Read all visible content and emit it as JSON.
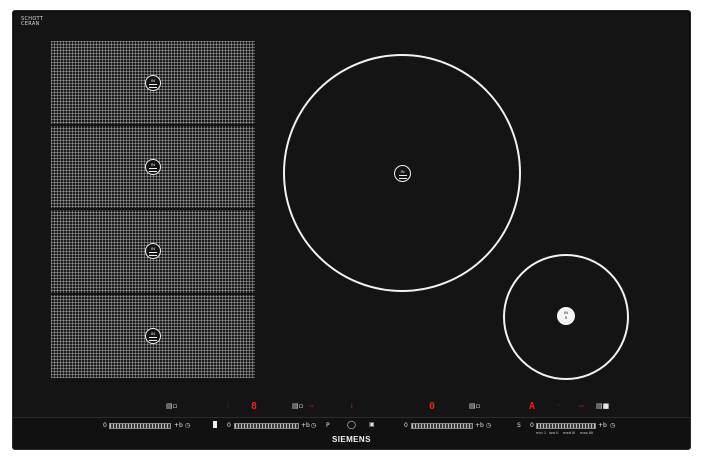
{
  "logo": {
    "line1": "SCHOTT",
    "line2": "CERAN",
    "line3": ""
  },
  "flex_zone": {
    "sections": [
      {
        "badge_label": "IN"
      },
      {
        "badge_label": "IN"
      },
      {
        "badge_label": "IN"
      },
      {
        "badge_label": "IN"
      }
    ]
  },
  "large_zone": {
    "badge_label": "IN"
  },
  "small_zone": {
    "badge_top": "IN",
    "badge_bottom": "S"
  },
  "displays": {
    "zone1_level": "8",
    "zone2_timer": "0",
    "zone3_level": "A",
    "zone3_small": "′′",
    "warn_indicator": "I"
  },
  "icons": {
    "flex_mode": "flex-mode-icon",
    "timer": "clock-icon",
    "power": "power-icon",
    "boost": "boost-icon",
    "lock": "lock-icon",
    "fry_sensor": "fry-sensor-icon"
  },
  "controls": {
    "slider_min": "0",
    "boost_label": "+b",
    "pause_label": "P",
    "fry_sensor_label": "S",
    "brand": "SIEMENS",
    "scale_labels": [
      "min 1",
      "low II",
      "med III",
      "max IIII"
    ]
  },
  "colors": {
    "glass": "#141414",
    "display_red": "#e2231a",
    "marking_white": "#f0f0f0"
  }
}
